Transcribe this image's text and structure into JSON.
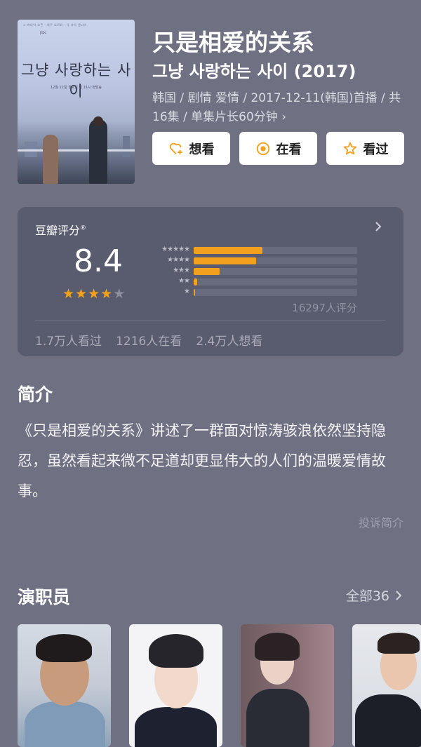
{
  "movie": {
    "title": "只是相爱的关系",
    "subtitle": "그냥 사랑하는 사이 (2017)",
    "meta": "韩国 / 剧情 爱情 / 2017-12-11(韩国)首播 / 共16集 / 单集片长60分钟 ›",
    "poster": {
      "top_text": "그 바다이 오픈 · 내우 오르와 · 다 사이 낸니마",
      "tag": "jtbc",
      "title": "그냥 사랑하는 사이",
      "sub": "12월 11일 월요일 밤 11시 첫방송"
    }
  },
  "actions": [
    {
      "label": "想看",
      "icon": "heart-plus-icon"
    },
    {
      "label": "在看",
      "icon": "target-icon"
    },
    {
      "label": "看过",
      "icon": "star-outline-icon"
    }
  ],
  "rating": {
    "label": "豆瓣评分",
    "mark": "®",
    "score": "8.4",
    "stars_filled": 4,
    "stars_total": 5,
    "distribution": [
      {
        "label": "★★★★★",
        "fraction": 0.42
      },
      {
        "label": "★★★★",
        "fraction": 0.38
      },
      {
        "label": "★★★",
        "fraction": 0.16
      },
      {
        "label": "★★",
        "fraction": 0.02
      },
      {
        "label": "★",
        "fraction": 0.005
      }
    ],
    "count_text": "16297人评分",
    "watched": "1.7万人看过",
    "watching": "1216人在看",
    "want": "2.4万人想看",
    "colors": {
      "star": "#f2a01e",
      "bar": "#f2a01e"
    }
  },
  "intro": {
    "heading": "简介",
    "text": "《只是相爱的关系》讲述了一群面对惊涛骇浪依然坚持隐忍，虽然看起来微不足道却更显伟大的人们的温暖爱情故事。",
    "complain": "投诉简介"
  },
  "cast": {
    "heading": "演职员",
    "all_label": "全部36"
  }
}
